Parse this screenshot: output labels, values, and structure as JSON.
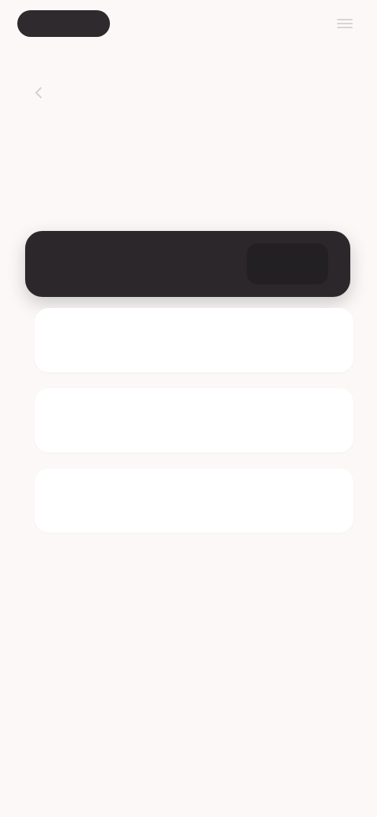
{
  "topbar": {
    "logo_text": "",
    "menu_icon": "menu-icon"
  },
  "subrow": {
    "back_icon": "chevron-left-icon",
    "text": "",
    "action": ""
  },
  "heading": "",
  "primary_field": {
    "placeholder": "",
    "button_label": ""
  },
  "options": [
    {
      "title": "",
      "subtitle": ""
    },
    {
      "title": "",
      "subtitle": ""
    },
    {
      "title": "",
      "subtitle": ""
    }
  ],
  "colors": {
    "background": "#fbf8f7",
    "dark": "#2b272a",
    "card": "#ffffff"
  }
}
